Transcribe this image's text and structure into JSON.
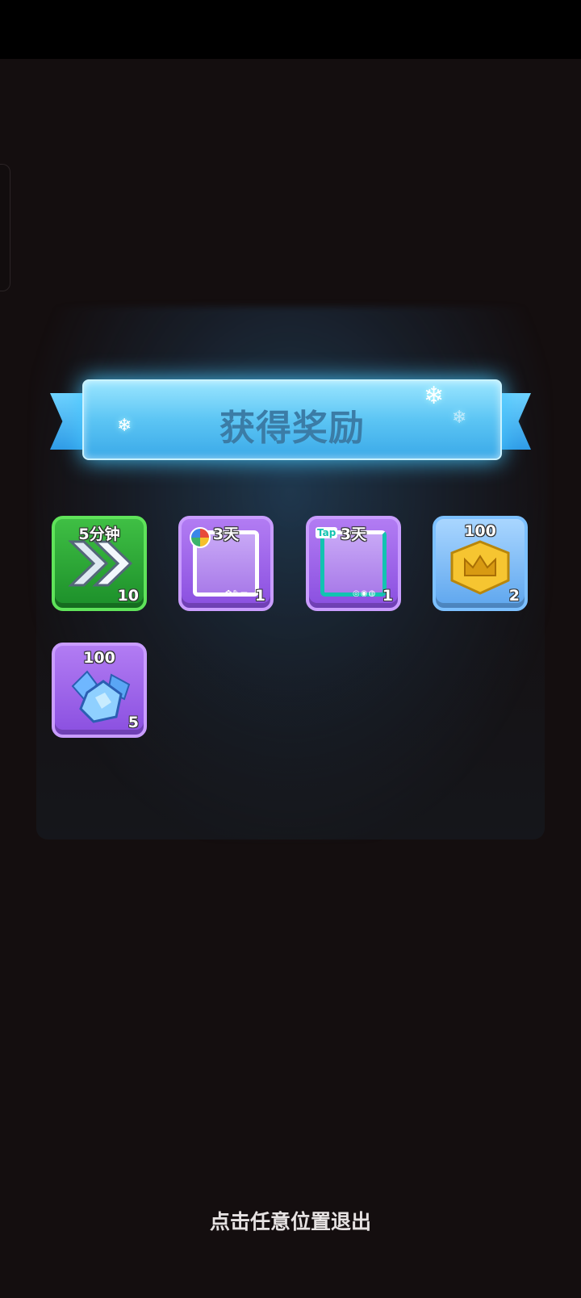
{
  "banner": {
    "title": "获得奖励"
  },
  "rewards": [
    {
      "top": "5分钟",
      "count": "10",
      "icon": "double-chevron-speedup-icon",
      "style": "green"
    },
    {
      "top": "3天",
      "count": "1",
      "icon": "avatar-frame-icon",
      "style": "purple"
    },
    {
      "top": "3天",
      "count": "1",
      "icon": "avatar-frame-tap-icon",
      "style": "purple",
      "brand": "Tap"
    },
    {
      "top": "100",
      "count": "2",
      "icon": "gold-crown-badge-icon",
      "style": "blue"
    },
    {
      "top": "100",
      "count": "5",
      "icon": "blue-crystal-icon",
      "style": "purple"
    }
  ],
  "footer": {
    "hint": "点击任意位置退出"
  },
  "colors": {
    "banner": "#5cc5f4",
    "background": "#140e0f",
    "green_tile": "#3fbf44",
    "purple_tile": "#a66cf0",
    "blue_tile": "#7cc0ff"
  }
}
